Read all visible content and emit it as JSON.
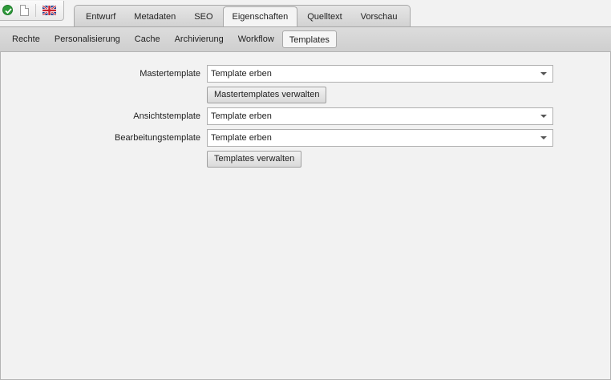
{
  "toolbar": {
    "icons": [
      "check-icon",
      "document-icon",
      "uk-flag-icon"
    ]
  },
  "main_tabs": [
    {
      "label": "Entwurf",
      "active": false
    },
    {
      "label": "Metadaten",
      "active": false
    },
    {
      "label": "SEO",
      "active": false
    },
    {
      "label": "Eigenschaften",
      "active": true
    },
    {
      "label": "Quelltext",
      "active": false
    },
    {
      "label": "Vorschau",
      "active": false
    }
  ],
  "sub_tabs": [
    {
      "label": "Rechte",
      "active": false
    },
    {
      "label": "Personalisierung",
      "active": false
    },
    {
      "label": "Cache",
      "active": false
    },
    {
      "label": "Archivierung",
      "active": false
    },
    {
      "label": "Workflow",
      "active": false
    },
    {
      "label": "Templates",
      "active": true
    }
  ],
  "form": {
    "master": {
      "label": "Mastertemplate",
      "value": "Template erben"
    },
    "master_manage_button": "Mastertemplates verwalten",
    "view": {
      "label": "Ansichtstemplate",
      "value": "Template erben"
    },
    "edit": {
      "label": "Bearbeitungstemplate",
      "value": "Template erben"
    },
    "templates_manage_button": "Templates verwalten"
  },
  "colors": {
    "check": "#2e9a3a",
    "background": "#f2f2f2"
  }
}
